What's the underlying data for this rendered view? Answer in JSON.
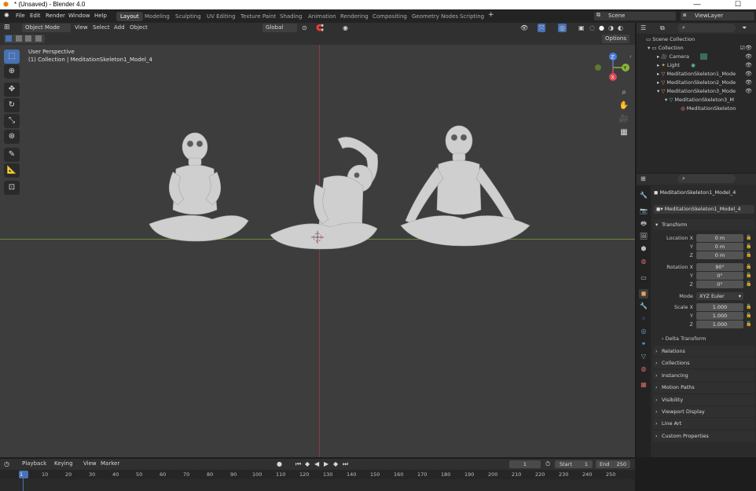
{
  "window": {
    "title": "* (Unsaved) - Blender 4.0",
    "minimize": "—",
    "maximize": "☐"
  },
  "menu": [
    "File",
    "Edit",
    "Render",
    "Window",
    "Help"
  ],
  "workspaces": [
    "Layout",
    "Modeling",
    "Sculpting",
    "UV Editing",
    "Texture Paint",
    "Shading",
    "Animation",
    "Rendering",
    "Compositing",
    "Geometry Nodes",
    "Scripting"
  ],
  "scene": "Scene",
  "view_layer": "ViewLayer",
  "viewport_header": {
    "mode": "Object Mode",
    "menus": [
      "View",
      "Select",
      "Add",
      "Object"
    ],
    "transform_orientation": "Global",
    "options": "Options"
  },
  "viewport": {
    "perspective": "User Perspective",
    "collection_info": "(1) Collection | MeditationSkeleton1_Model_4"
  },
  "outliner": {
    "root": "Scene Collection",
    "items": [
      {
        "label": "Collection",
        "indent": 0
      },
      {
        "label": "Camera",
        "indent": 1
      },
      {
        "label": "Light",
        "indent": 1
      },
      {
        "label": "MeditationSkeleton1_Mode",
        "indent": 1
      },
      {
        "label": "MeditationSkeleton2_Mode",
        "indent": 1
      },
      {
        "label": "MeditationSkeleton3_Mode",
        "indent": 1
      },
      {
        "label": "MeditationSkeleton3_M",
        "indent": 2
      },
      {
        "label": "MeditationSkeleton",
        "indent": 3
      }
    ]
  },
  "properties": {
    "object_name": "MeditationSkeleton1_Model_4",
    "object_field": "MeditationSkeleton1_Model_4",
    "transform_label": "Transform",
    "location": {
      "label": "Location X",
      "x": "0 m",
      "y": "0 m",
      "z": "0 m"
    },
    "rotation": {
      "label": "Rotation X",
      "x": "90°",
      "y": "0°",
      "z": "0°"
    },
    "mode_label": "Mode",
    "mode_value": "XYZ Euler",
    "scale": {
      "label": "Scale X",
      "x": "1.000",
      "y": "1.000",
      "z": "1.000"
    },
    "axis_y": "Y",
    "axis_z": "Z",
    "delta": "Delta Transform",
    "sections": [
      "Relations",
      "Collections",
      "Instancing",
      "Motion Paths",
      "Visibility",
      "Viewport Display",
      "Line Art",
      "Custom Properties"
    ]
  },
  "timeline": {
    "menus": [
      "Playback",
      "Keying",
      "View",
      "Marker"
    ],
    "current_frame": "1",
    "start_label": "Start",
    "start": "1",
    "end_label": "End",
    "end": "250",
    "ruler": [
      "1",
      "10",
      "20",
      "30",
      "40",
      "50",
      "60",
      "70",
      "80",
      "90",
      "100",
      "110",
      "120",
      "130",
      "140",
      "150",
      "160",
      "170",
      "180",
      "190",
      "200",
      "210",
      "220",
      "230",
      "240",
      "250"
    ]
  },
  "gizmo": {
    "x": "X",
    "y": "Y",
    "z": "Z"
  }
}
